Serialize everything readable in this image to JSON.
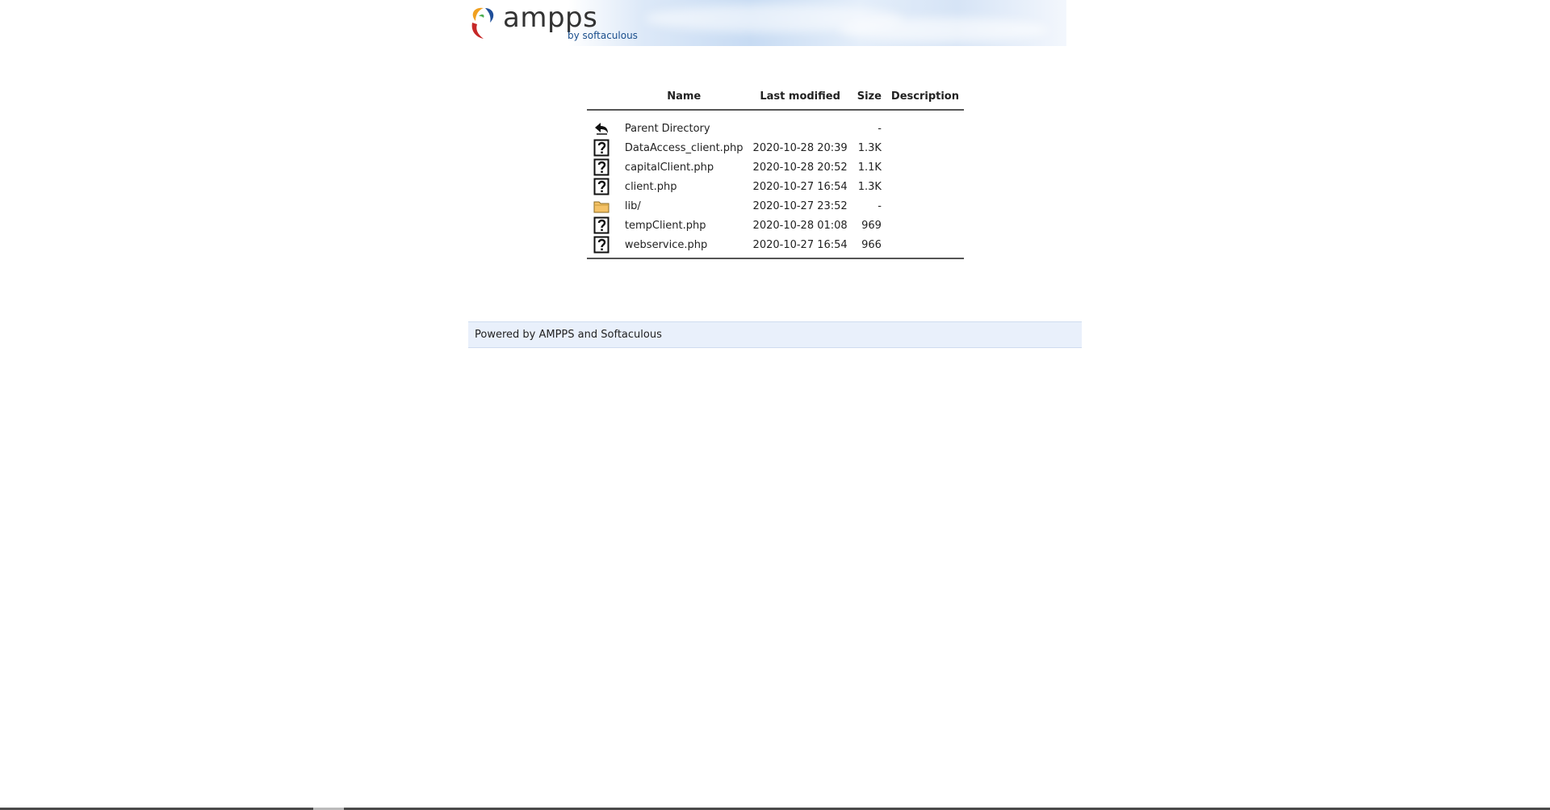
{
  "header": {
    "logo_text": "ampps",
    "logo_sub": "by softaculous"
  },
  "table": {
    "columns": {
      "name": "Name",
      "last_modified": "Last modified",
      "size": "Size",
      "description": "Description"
    },
    "rows": [
      {
        "icon": "back-arrow-icon",
        "name": "Parent Directory",
        "modified": "",
        "size": "-",
        "description": ""
      },
      {
        "icon": "unknown-file-icon",
        "name": "DataAccess_client.php",
        "modified": "2020-10-28 20:39",
        "size": "1.3K",
        "description": ""
      },
      {
        "icon": "unknown-file-icon",
        "name": "capitalClient.php",
        "modified": "2020-10-28 20:52",
        "size": "1.1K",
        "description": ""
      },
      {
        "icon": "unknown-file-icon",
        "name": "client.php",
        "modified": "2020-10-27 16:54",
        "size": "1.3K",
        "description": ""
      },
      {
        "icon": "folder-icon",
        "name": "lib/",
        "modified": "2020-10-27 23:52",
        "size": "-",
        "description": ""
      },
      {
        "icon": "unknown-file-icon",
        "name": "tempClient.php",
        "modified": "2020-10-28 01:08",
        "size": "969",
        "description": ""
      },
      {
        "icon": "unknown-file-icon",
        "name": "webservice.php",
        "modified": "2020-10-27 16:54",
        "size": "966",
        "description": ""
      }
    ]
  },
  "footer": {
    "prefix": "Powered by ",
    "ampps_link": "AMPPS",
    "and": " and ",
    "softaculous_link": "Softaculous"
  }
}
